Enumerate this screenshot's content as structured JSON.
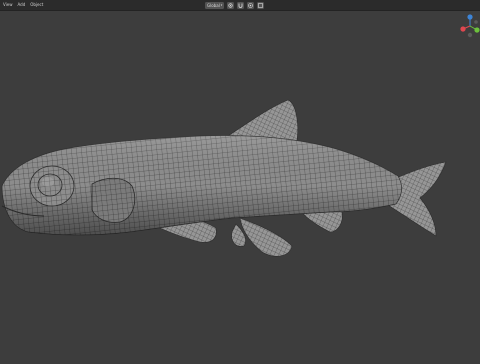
{
  "menu": {
    "items": [
      "View",
      "Add",
      "Object"
    ]
  },
  "header": {
    "orientation_label": "Global"
  },
  "gizmo": {
    "colors": {
      "x": "#e0474f",
      "y": "#6cc13c",
      "z": "#3d84d6",
      "neg": "#5a5a5a"
    }
  },
  "viewport": {
    "background_color": "#3d3d3d",
    "model_color": "#8a8a8a",
    "wireframe_color": "#2a2a2a"
  }
}
